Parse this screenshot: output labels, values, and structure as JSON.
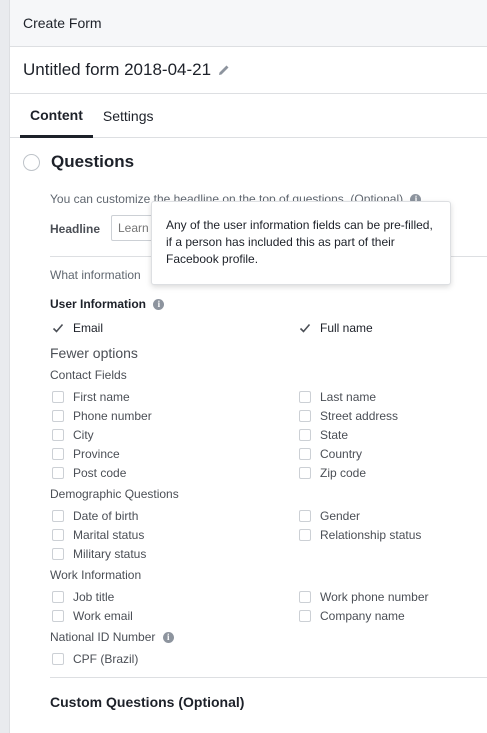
{
  "header": {
    "title": "Create Form"
  },
  "form": {
    "title": "Untitled form 2018-04-21"
  },
  "tabs": [
    {
      "label": "Content"
    },
    {
      "label": "Settings"
    }
  ],
  "questions": {
    "title": "Questions",
    "customize_text": "You can customize the headline on the top of questions. (Optional)",
    "headline_label": "Headline",
    "headline_placeholder": "Learn more",
    "what_info_text": "What information",
    "user_info_label": "User Information",
    "tooltip": "Any of the user information fields can be pre-filled, if a person has included this as part of their Facebook profile.",
    "user_fields": [
      {
        "label": "Email",
        "checked": true
      },
      {
        "label": "Full name",
        "checked": true
      }
    ],
    "fewer_options": "Fewer options",
    "contact_fields": {
      "label": "Contact Fields",
      "items": [
        "First name",
        "Last name",
        "Phone number",
        "Street address",
        "City",
        "State",
        "Province",
        "Country",
        "Post code",
        "Zip code"
      ]
    },
    "demographic": {
      "label": "Demographic Questions",
      "items": [
        "Date of birth",
        "Gender",
        "Marital status",
        "Relationship status",
        "Military status"
      ]
    },
    "work": {
      "label": "Work Information",
      "items": [
        "Job title",
        "Work phone number",
        "Work email",
        "Company name"
      ]
    },
    "national_id": {
      "label": "National ID Number",
      "items": [
        "CPF (Brazil)"
      ]
    }
  },
  "custom_questions": {
    "title": "Custom Questions (Optional)"
  }
}
